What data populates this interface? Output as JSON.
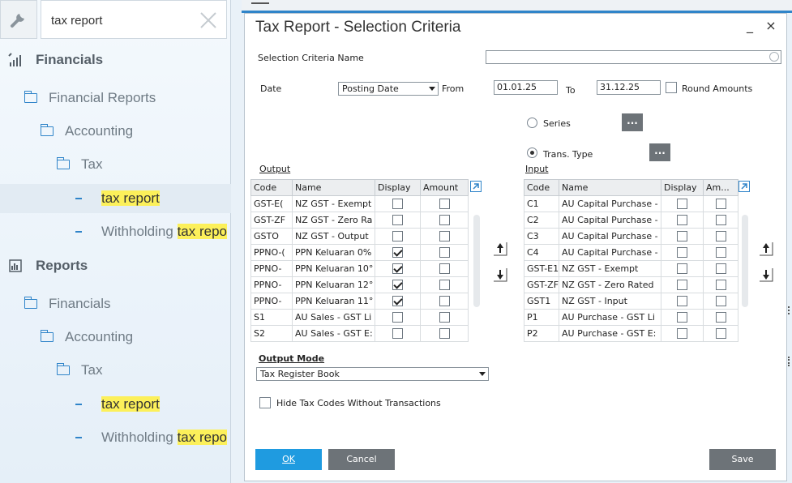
{
  "nav": {
    "search_value": "tax report",
    "icons": {
      "tool": "wrench-icon",
      "clear": "close-icon"
    },
    "items": [
      {
        "label": "Financials",
        "type": "section",
        "icon": "financials-icon"
      },
      {
        "label": "Financial Reports",
        "type": "folder"
      },
      {
        "label": "Accounting",
        "type": "folder"
      },
      {
        "label": "Tax",
        "type": "folder"
      },
      {
        "label": "tax report",
        "type": "leaf",
        "highlight": "tax report",
        "selected": true
      },
      {
        "label_prefix": "Withholding ",
        "highlight": "tax repo",
        "type": "leaf"
      },
      {
        "label": "Reports",
        "type": "section",
        "icon": "reports-icon"
      },
      {
        "label": "Financials",
        "type": "folder"
      },
      {
        "label": "Accounting",
        "type": "folder"
      },
      {
        "label": "Tax",
        "type": "folder"
      },
      {
        "label": "tax report",
        "type": "leaf",
        "highlight": "tax report"
      },
      {
        "label_prefix": "Withholding ",
        "highlight": "tax repo",
        "type": "leaf"
      }
    ]
  },
  "dialog": {
    "title": "Tax Report - Selection Criteria",
    "minimize": "_",
    "close": "×",
    "criteria_name_label": "Selection Criteria Name",
    "criteria_name_value": "",
    "date_label": "Date",
    "date_type": "Posting Date",
    "from_label": "From",
    "from_value": "01.01.25",
    "to_label": "To",
    "to_value": "31.12.25",
    "round_amounts_label": "Round Amounts",
    "round_amounts_checked": false,
    "series_label": "Series",
    "trans_type_label": "Trans. Type",
    "selected_radio": "trans_type",
    "ellipsis": "...",
    "output": {
      "title": "Output",
      "columns": [
        "Code",
        "Name",
        "Display",
        "Amount"
      ],
      "rows": [
        {
          "code": "GST-E(",
          "name": "NZ GST - Exempt",
          "display": false,
          "amount": false
        },
        {
          "code": "GST-ZF",
          "name": "NZ GST - Zero Ra",
          "display": false,
          "amount": false
        },
        {
          "code": "GSTO",
          "name": "NZ GST - Output",
          "display": false,
          "amount": false
        },
        {
          "code": "PPNO-(",
          "name": "PPN Keluaran 0%",
          "display": true,
          "amount": false
        },
        {
          "code": "PPNO-",
          "name": "PPN Keluaran 10°",
          "display": true,
          "amount": false
        },
        {
          "code": "PPNO-",
          "name": "PPN Keluaran 12°",
          "display": true,
          "amount": false
        },
        {
          "code": "PPNO-",
          "name": "PPN Keluaran 11°",
          "display": true,
          "amount": false
        },
        {
          "code": "S1",
          "name": "AU Sales - GST Li",
          "display": false,
          "amount": false
        },
        {
          "code": "S2",
          "name": "AU Sales - GST E:",
          "display": false,
          "amount": false
        }
      ]
    },
    "input": {
      "title": "Input",
      "columns": [
        "Code",
        "Name",
        "Display",
        "Am..."
      ],
      "rows": [
        {
          "code": "C1",
          "name": "AU Capital Purchase -",
          "display": false,
          "amount": false
        },
        {
          "code": "C2",
          "name": "AU Capital Purchase -",
          "display": false,
          "amount": false
        },
        {
          "code": "C3",
          "name": "AU Capital Purchase -",
          "display": false,
          "amount": false
        },
        {
          "code": "C4",
          "name": "AU Capital Purchase -",
          "display": false,
          "amount": false
        },
        {
          "code": "GST-E1",
          "name": "NZ GST - Exempt",
          "display": false,
          "amount": false
        },
        {
          "code": "GST-ZF",
          "name": "NZ GST - Zero Rated",
          "display": false,
          "amount": false
        },
        {
          "code": "GST1",
          "name": "NZ GST - Input",
          "display": false,
          "amount": false
        },
        {
          "code": "P1",
          "name": "AU Purchase - GST Li",
          "display": false,
          "amount": false
        },
        {
          "code": "P2",
          "name": "AU Purchase - GST E:",
          "display": false,
          "amount": false
        }
      ]
    },
    "output_mode_label": "Output Mode",
    "output_mode_value": "Tax Register Book",
    "hide_codes_label": "Hide Tax Codes Without Transactions",
    "hide_codes_checked": false,
    "ok_label": "OK",
    "cancel_label": "Cancel",
    "save_label": "Save",
    "colors": {
      "accent": "#1f9be0",
      "button_gray": "#6d7378",
      "highlight": "#fcf05a",
      "nav_icon": "#2f84c9"
    }
  }
}
